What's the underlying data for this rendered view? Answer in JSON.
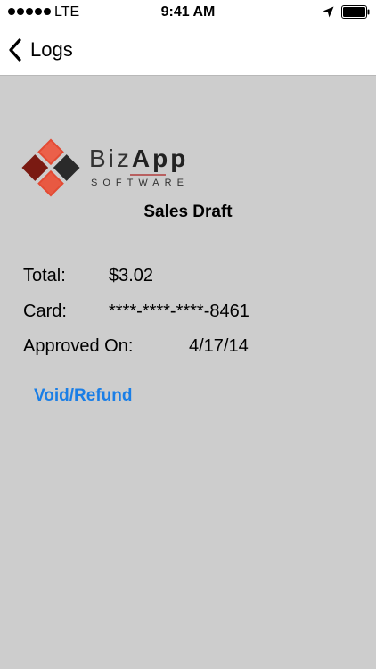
{
  "status_bar": {
    "carrier": "LTE",
    "time": "9:41 AM",
    "signal_dots": 5
  },
  "nav": {
    "back_label": "Logs"
  },
  "logo": {
    "name_light": "Biz",
    "name_bold": "App",
    "subtitle": "SOFTWARE",
    "colors": {
      "red": "#e34a33",
      "dark_red": "#7a1a12",
      "dark": "#2a2a2a"
    }
  },
  "receipt": {
    "title": "Sales Draft",
    "total_label": "Total:",
    "total_value": "$3.02",
    "card_label": "Card:",
    "card_value": "****-****-****-8461",
    "approved_label": "Approved On:",
    "approved_value": "4/17/14"
  },
  "actions": {
    "void_refund_label": "Void/Refund"
  },
  "colors": {
    "link": "#1a7ee6",
    "background": "#cdcdcd"
  }
}
